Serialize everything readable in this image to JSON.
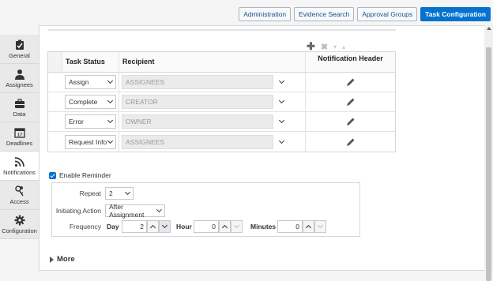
{
  "topnav": {
    "tabs": [
      {
        "label": "Administration"
      },
      {
        "label": "Evidence Search"
      },
      {
        "label": "Approval Groups"
      },
      {
        "label": "Task Configuration"
      }
    ]
  },
  "sidebar": {
    "items": [
      {
        "label": "General",
        "icon": "clipboard-check-icon"
      },
      {
        "label": "Assignees",
        "icon": "person-icon"
      },
      {
        "label": "Data",
        "icon": "briefcase-icon"
      },
      {
        "label": "Deadlines",
        "icon": "calendar-icon"
      },
      {
        "label": "Notifications",
        "icon": "rss-icon"
      },
      {
        "label": "Access",
        "icon": "keys-icon"
      },
      {
        "label": "Configuration",
        "icon": "gear-icon"
      }
    ],
    "active": "Notifications"
  },
  "notifications": {
    "headers": {
      "status": "Task Status",
      "recipient": "Recipient",
      "notification_header": "Notification Header"
    },
    "rows": [
      {
        "status": "Assign",
        "recipient": "ASSIGNEES"
      },
      {
        "status": "Complete",
        "recipient": "CREATOR"
      },
      {
        "status": "Error",
        "recipient": "OWNER"
      },
      {
        "status": "Request Info",
        "recipient": "ASSIGNEES"
      }
    ]
  },
  "reminder": {
    "enable_label": "Enable Reminder",
    "enabled": true,
    "repeat_label": "Repeat",
    "repeat_value": "2",
    "initiating_action_label": "Initiating Action",
    "initiating_action_value": "After Assignment",
    "frequency_label": "Frequency",
    "day_label": "Day",
    "day_value": "2",
    "hour_label": "Hour",
    "hour_value": "0",
    "minutes_label": "Minutes",
    "minutes_value": "0"
  },
  "more_label": "More",
  "colors": {
    "accent": "#0572ce"
  }
}
